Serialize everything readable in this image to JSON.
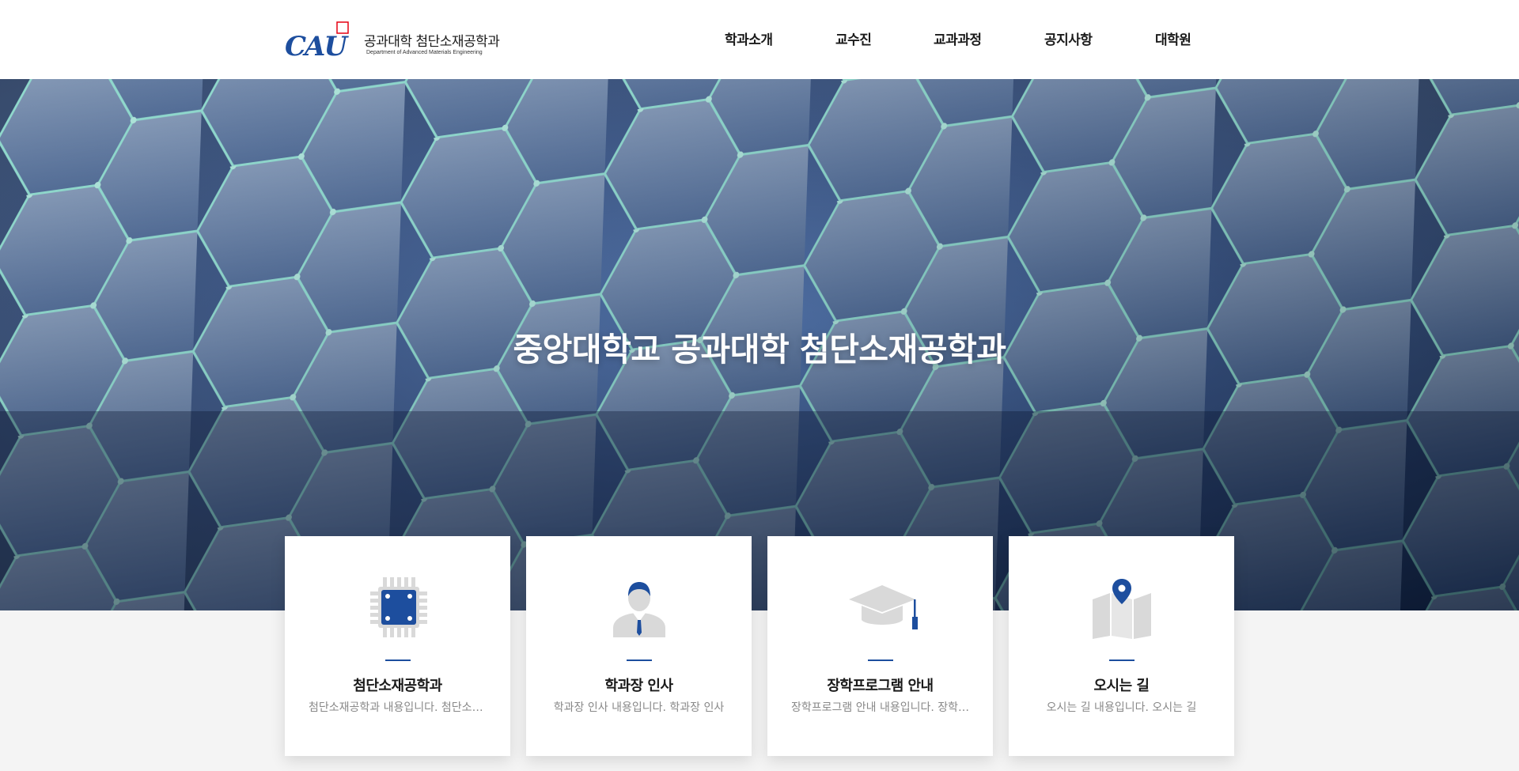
{
  "header": {
    "logo_mark": "CAU",
    "logo_title": "공과대학 첨단소재공학과",
    "logo_subtitle": "Department of Advanced Materials Engineering",
    "nav": [
      {
        "label": "학과소개"
      },
      {
        "label": "교수진"
      },
      {
        "label": "교과과정"
      },
      {
        "label": "공지사항"
      },
      {
        "label": "대학원"
      }
    ]
  },
  "hero": {
    "title": "중앙대학교 공과대학 첨단소재공학과"
  },
  "cards": [
    {
      "icon": "chip-icon",
      "title": "첨단소재공학과",
      "desc": "첨단소재공학과 내용입니다. 첨단소재공학과"
    },
    {
      "icon": "person-icon",
      "title": "학과장 인사",
      "desc": "학과장 인사 내용입니다. 학과장 인사"
    },
    {
      "icon": "graduation-cap-icon",
      "title": "장학프로그램 안내",
      "desc": "장학프로그램 안내 내용입니다. 장학프로그램"
    },
    {
      "icon": "map-pin-icon",
      "title": "오시는 길",
      "desc": "오시는 길 내용입니다. 오시는 길"
    }
  ],
  "colors": {
    "brand_blue": "#1d4e9e",
    "logo_red": "#e60012",
    "icon_gray": "#d9d9d9"
  }
}
